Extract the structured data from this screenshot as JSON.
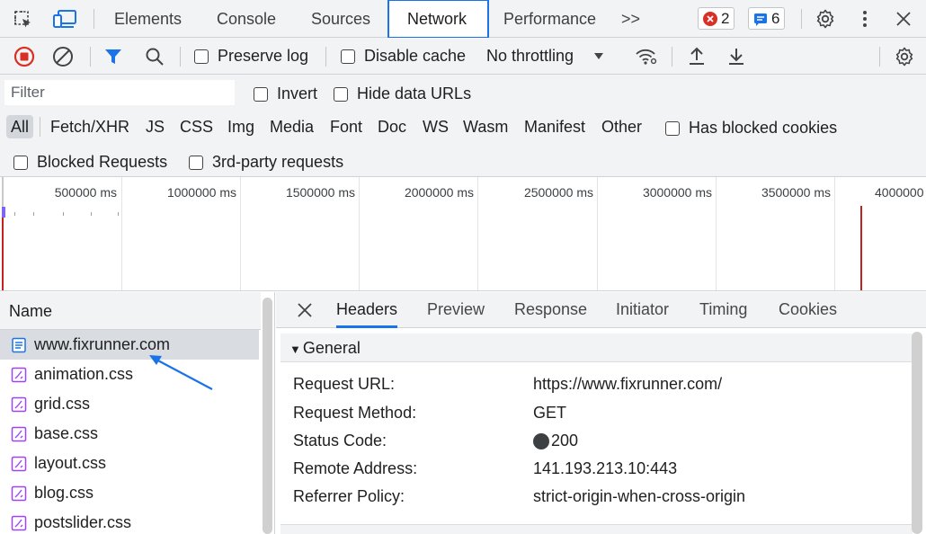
{
  "topbar": {
    "tabs": [
      {
        "label": "Elements"
      },
      {
        "label": "Console"
      },
      {
        "label": "Sources"
      },
      {
        "label": "Network"
      },
      {
        "label": "Performance"
      }
    ],
    "more_label": ">>",
    "errors_count": "2",
    "messages_count": "6",
    "error_color": "#d93025",
    "message_color": "#1a73e8"
  },
  "toolbar": {
    "preserve_log": "Preserve log",
    "disable_cache": "Disable cache",
    "throttling": "No throttling"
  },
  "filter": {
    "placeholder": "Filter",
    "invert": "Invert",
    "hide_data_urls": "Hide data URLs"
  },
  "types": [
    "All",
    "Fetch/XHR",
    "JS",
    "CSS",
    "Img",
    "Media",
    "Font",
    "Doc",
    "WS",
    "Wasm",
    "Manifest",
    "Other"
  ],
  "has_blocked_cookies": "Has blocked cookies",
  "blocked_requests": "Blocked Requests",
  "third_party": "3rd-party requests",
  "timeline": {
    "ticks": [
      "500000 ms",
      "1000000 ms",
      "1500000 ms",
      "2000000 ms",
      "2500000 ms",
      "3000000 ms",
      "3500000 ms",
      "4000000"
    ]
  },
  "requests": {
    "header": "Name",
    "items": [
      {
        "name": "www.fixrunner.com",
        "kind": "document"
      },
      {
        "name": "animation.css",
        "kind": "stylesheet"
      },
      {
        "name": "grid.css",
        "kind": "stylesheet"
      },
      {
        "name": "base.css",
        "kind": "stylesheet"
      },
      {
        "name": "layout.css",
        "kind": "stylesheet"
      },
      {
        "name": "blog.css",
        "kind": "stylesheet"
      },
      {
        "name": "postslider.css",
        "kind": "stylesheet"
      }
    ]
  },
  "details": {
    "tabs": [
      "Headers",
      "Preview",
      "Response",
      "Initiator",
      "Timing",
      "Cookies"
    ],
    "general_title": "General",
    "general": [
      {
        "key": "Request URL:",
        "value": "https://www.fixrunner.com/"
      },
      {
        "key": "Request Method:",
        "value": "GET"
      },
      {
        "key": "Status Code:",
        "value": "200"
      },
      {
        "key": "Remote Address:",
        "value": "141.193.213.10:443"
      },
      {
        "key": "Referrer Policy:",
        "value": "strict-origin-when-cross-origin"
      }
    ]
  },
  "colors": {
    "accent": "#1a73e8",
    "record_red": "#d93025",
    "css_icon": "#a142f4",
    "annotation_arrow": "#1a73e8"
  }
}
